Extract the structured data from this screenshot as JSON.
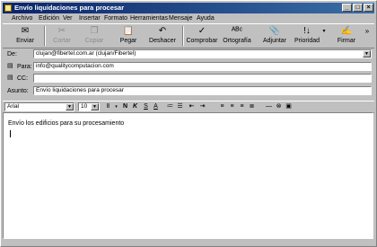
{
  "window": {
    "title": "Envío liquidaciones para procesar"
  },
  "title_buttons": {
    "minimize": "_",
    "maximize": "□",
    "close": "×"
  },
  "menu": [
    "Archivo",
    "Edición",
    "Ver",
    "Insertar",
    "Formato",
    "Herramientas",
    "Mensaje",
    "Ayuda"
  ],
  "toolbar": {
    "send": "Enviar",
    "cut": "Cortar",
    "copy": "Copiar",
    "paste": "Pegar",
    "undo": "Deshacer",
    "check": "Comprobar",
    "spelling": "Ortografía",
    "attach": "Adjuntar",
    "priority": "Prioridad",
    "sign": "Firmar",
    "more": "»"
  },
  "headers": {
    "from_label": "De:",
    "from_value": "clujan@fibertel.com.ar   (clujan/Fibertel)",
    "to_label": "Para:",
    "to_value": "info@qualitycomputacion.com",
    "cc_label": "CC:",
    "cc_value": "",
    "subject_label": "Asunto:",
    "subject_value": "Envío liquidaciones para procesar"
  },
  "format": {
    "font": "Arial",
    "size": "10"
  },
  "message": {
    "body": "Envío los edificios para su procesamiento"
  }
}
